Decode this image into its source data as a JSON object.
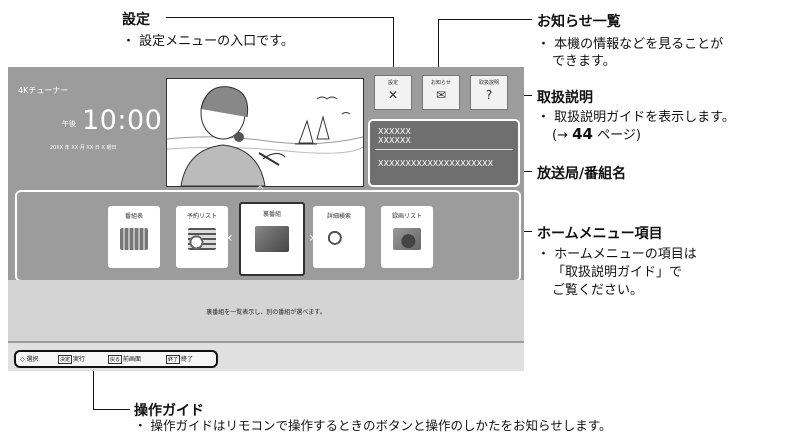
{
  "annotations": {
    "settings": {
      "title": "設定",
      "bullet": "・ 設定メニューの入口です。"
    },
    "notices": {
      "title": "お知らせ一覧",
      "bullet1": "・ 本機の情報などを見ることが",
      "bullet2": "できます。"
    },
    "manual": {
      "title": "取扱説明",
      "bullet1": "・ 取扱説明ガイドを表示します。",
      "bullet2_prefix": "(→ ",
      "bullet2_num": "44",
      "bullet2_suffix": " ページ)"
    },
    "station": {
      "title": "放送局/番組名"
    },
    "home_menu": {
      "title": "ホームメニュー項目",
      "bullet1": "・ ホームメニューの項目は",
      "bullet2": "「取扱説明ガイド」で",
      "bullet3": "ご覧ください。"
    },
    "guide": {
      "title": "操作ガイド",
      "bullet": "・ 操作ガイドはリモコンで操作するときのボタンと操作のしかたをお知らせします。"
    }
  },
  "screen": {
    "tuner_label": "4Kチューナー",
    "ampm": "午後",
    "time": "10:00",
    "date": "20XX 年 XX 月 XX 日 X 曜日",
    "top_buttons": [
      {
        "label": "設定",
        "icon": "tools-icon",
        "glyph": "✕"
      },
      {
        "label": "お知らせ",
        "icon": "envelope-icon",
        "glyph": "✉"
      },
      {
        "label": "取扱説明",
        "icon": "question-icon",
        "glyph": "?"
      }
    ],
    "station": {
      "line1": "XXXXXX",
      "line2": "XXXXXX",
      "program": "XXXXXXXXXXXXXXXXXXXXX"
    },
    "menu_items": [
      {
        "label": "番組表",
        "selected": false
      },
      {
        "label": "予約リスト",
        "selected": false
      },
      {
        "label": "裏番組",
        "selected": true
      },
      {
        "label": "詳細検索",
        "selected": false
      },
      {
        "label": "録画リスト",
        "selected": false
      }
    ],
    "description": "裏番組を一覧表示し、別の番組が選べます。",
    "guide_bar": {
      "select_key": "◇",
      "select": "選択",
      "decide_key": "決定",
      "decide": "実行",
      "back_key": "戻る",
      "back": "前画面",
      "end_key": "終了",
      "end": "終了"
    }
  }
}
